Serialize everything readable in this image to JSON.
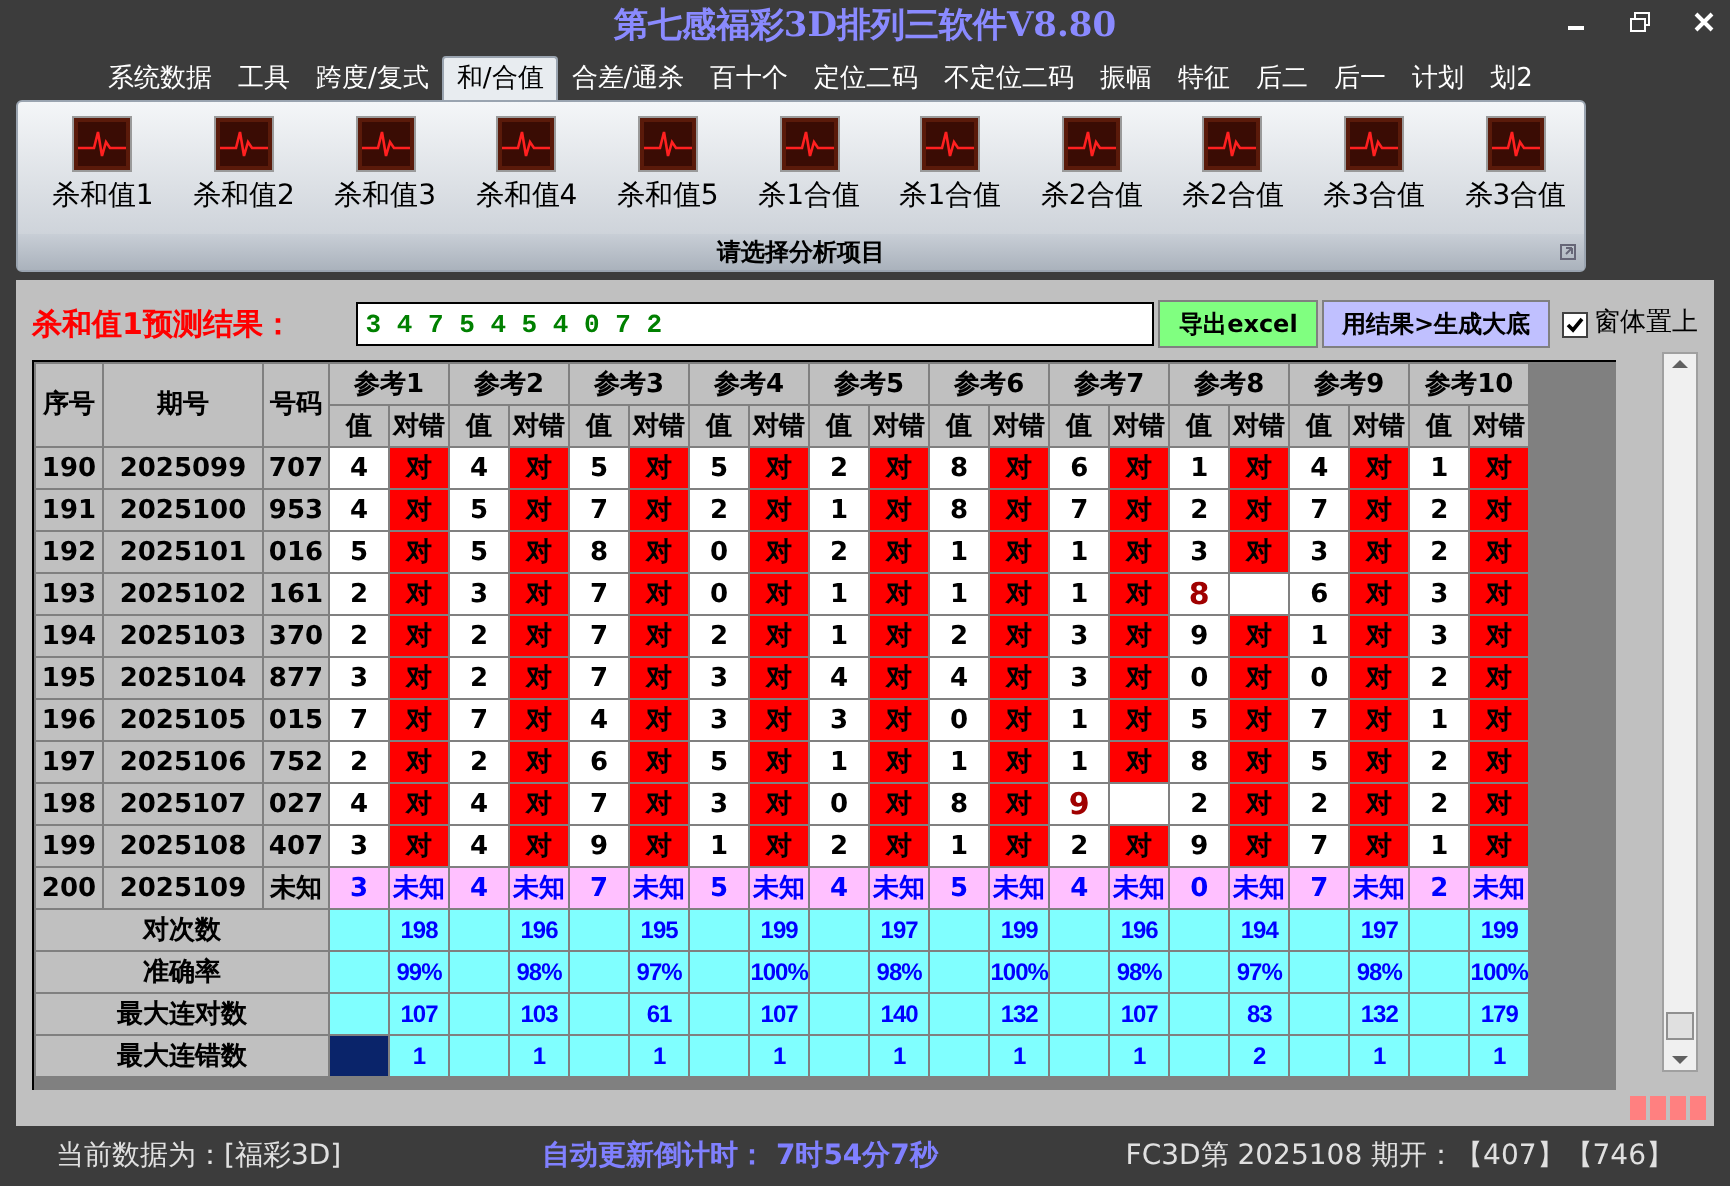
{
  "window": {
    "title": "第七感福彩3D排列三软件V8.80"
  },
  "tabs": [
    {
      "label": "系统数据",
      "selected": false
    },
    {
      "label": "工具",
      "selected": false
    },
    {
      "label": "跨度/复式",
      "selected": false
    },
    {
      "label": "和/合值",
      "selected": true
    },
    {
      "label": "合差/通杀",
      "selected": false
    },
    {
      "label": "百十个",
      "selected": false
    },
    {
      "label": "定位二码",
      "selected": false
    },
    {
      "label": "不定位二码",
      "selected": false
    },
    {
      "label": "振幅",
      "selected": false
    },
    {
      "label": "特征",
      "selected": false
    },
    {
      "label": "后二",
      "selected": false
    },
    {
      "label": "后一",
      "selected": false
    },
    {
      "label": "计划",
      "selected": false
    },
    {
      "label": "划2",
      "selected": false
    }
  ],
  "ribbon": {
    "items": [
      "杀和值1",
      "杀和值2",
      "杀和值3",
      "杀和值4",
      "杀和值5",
      "杀1合值",
      "杀1合值",
      "杀2合值",
      "杀2合值",
      "杀3合值",
      "杀3合值"
    ],
    "group_label": "请选择分析项目"
  },
  "prediction": {
    "label": "杀和值1预测结果：",
    "value": "3 4 7 5 4 5 4 0 7 2",
    "buttons": [
      {
        "label": "导出excel",
        "kind": "export"
      },
      {
        "label": "用结果>生成大底",
        "kind": "generate"
      }
    ],
    "checkbox": {
      "label": "窗体置上",
      "checked": true
    }
  },
  "table": {
    "columns": [
      "序号",
      "期号",
      "号码"
    ],
    "refs": [
      {
        "label": "参考1",
        "sub": [
          "值",
          "对错"
        ]
      },
      {
        "label": "参考2",
        "sub": [
          "值",
          "对错"
        ]
      },
      {
        "label": "参考3",
        "sub": [
          "值",
          "对错"
        ]
      },
      {
        "label": "参考4",
        "sub": [
          "值",
          "对错"
        ]
      },
      {
        "label": "参考5",
        "sub": [
          "值",
          "对错"
        ]
      },
      {
        "label": "参考6",
        "sub": [
          "值",
          "对错"
        ]
      },
      {
        "label": "参考7",
        "sub": [
          "值",
          "对错"
        ]
      },
      {
        "label": "参考8",
        "sub": [
          "值",
          "对错"
        ]
      },
      {
        "label": "参考9",
        "sub": [
          "值",
          "对错"
        ]
      },
      {
        "label": "参考10",
        "sub": [
          "值",
          "对错"
        ]
      }
    ],
    "rows": [
      {
        "index": "190",
        "issue": "2025099",
        "number": "707",
        "cells": [
          {
            "value": "4",
            "hit": true,
            "result": "对"
          },
          {
            "value": "4",
            "hit": true,
            "result": "对"
          },
          {
            "value": "5",
            "hit": true,
            "result": "对"
          },
          {
            "value": "5",
            "hit": true,
            "result": "对"
          },
          {
            "value": "2",
            "hit": true,
            "result": "对"
          },
          {
            "value": "8",
            "hit": true,
            "result": "对"
          },
          {
            "value": "6",
            "hit": true,
            "result": "对"
          },
          {
            "value": "1",
            "hit": true,
            "result": "对"
          },
          {
            "value": "4",
            "hit": true,
            "result": "对"
          },
          {
            "value": "1",
            "hit": true,
            "result": "对"
          }
        ]
      },
      {
        "index": "191",
        "issue": "2025100",
        "number": "953",
        "cells": [
          {
            "value": "4",
            "hit": true,
            "result": "对"
          },
          {
            "value": "5",
            "hit": true,
            "result": "对"
          },
          {
            "value": "7",
            "hit": true,
            "result": "对"
          },
          {
            "value": "2",
            "hit": true,
            "result": "对"
          },
          {
            "value": "1",
            "hit": true,
            "result": "对"
          },
          {
            "value": "8",
            "hit": true,
            "result": "对"
          },
          {
            "value": "7",
            "hit": true,
            "result": "对"
          },
          {
            "value": "2",
            "hit": true,
            "result": "对"
          },
          {
            "value": "7",
            "hit": true,
            "result": "对"
          },
          {
            "value": "2",
            "hit": true,
            "result": "对"
          }
        ]
      },
      {
        "index": "192",
        "issue": "2025101",
        "number": "016",
        "cells": [
          {
            "value": "5",
            "hit": true,
            "result": "对"
          },
          {
            "value": "5",
            "hit": true,
            "result": "对"
          },
          {
            "value": "8",
            "hit": true,
            "result": "对"
          },
          {
            "value": "0",
            "hit": true,
            "result": "对"
          },
          {
            "value": "2",
            "hit": true,
            "result": "对"
          },
          {
            "value": "1",
            "hit": true,
            "result": "对"
          },
          {
            "value": "1",
            "hit": true,
            "result": "对"
          },
          {
            "value": "3",
            "hit": true,
            "result": "对"
          },
          {
            "value": "3",
            "hit": true,
            "result": "对"
          },
          {
            "value": "2",
            "hit": true,
            "result": "对"
          }
        ]
      },
      {
        "index": "193",
        "issue": "2025102",
        "number": "161",
        "cells": [
          {
            "value": "2",
            "hit": true,
            "result": "对"
          },
          {
            "value": "3",
            "hit": true,
            "result": "对"
          },
          {
            "value": "7",
            "hit": true,
            "result": "对"
          },
          {
            "value": "0",
            "hit": true,
            "result": "对"
          },
          {
            "value": "1",
            "hit": true,
            "result": "对"
          },
          {
            "value": "1",
            "hit": true,
            "result": "对"
          },
          {
            "value": "1",
            "hit": true,
            "result": "对"
          },
          {
            "value": "8",
            "hit": false
          },
          {
            "value": "6",
            "hit": true,
            "result": "对"
          },
          {
            "value": "3",
            "hit": true,
            "result": "对"
          }
        ]
      },
      {
        "index": "194",
        "issue": "2025103",
        "number": "370",
        "cells": [
          {
            "value": "2",
            "hit": true,
            "result": "对"
          },
          {
            "value": "2",
            "hit": true,
            "result": "对"
          },
          {
            "value": "7",
            "hit": true,
            "result": "对"
          },
          {
            "value": "2",
            "hit": true,
            "result": "对"
          },
          {
            "value": "1",
            "hit": true,
            "result": "对"
          },
          {
            "value": "2",
            "hit": true,
            "result": "对"
          },
          {
            "value": "3",
            "hit": true,
            "result": "对"
          },
          {
            "value": "9",
            "hit": true,
            "result": "对"
          },
          {
            "value": "1",
            "hit": true,
            "result": "对"
          },
          {
            "value": "3",
            "hit": true,
            "result": "对"
          }
        ]
      },
      {
        "index": "195",
        "issue": "2025104",
        "number": "877",
        "cells": [
          {
            "value": "3",
            "hit": true,
            "result": "对"
          },
          {
            "value": "2",
            "hit": true,
            "result": "对"
          },
          {
            "value": "7",
            "hit": true,
            "result": "对"
          },
          {
            "value": "3",
            "hit": true,
            "result": "对"
          },
          {
            "value": "4",
            "hit": true,
            "result": "对"
          },
          {
            "value": "4",
            "hit": true,
            "result": "对"
          },
          {
            "value": "3",
            "hit": true,
            "result": "对"
          },
          {
            "value": "0",
            "hit": true,
            "result": "对"
          },
          {
            "value": "0",
            "hit": true,
            "result": "对"
          },
          {
            "value": "2",
            "hit": true,
            "result": "对"
          }
        ]
      },
      {
        "index": "196",
        "issue": "2025105",
        "number": "015",
        "cells": [
          {
            "value": "7",
            "hit": true,
            "result": "对"
          },
          {
            "value": "7",
            "hit": true,
            "result": "对"
          },
          {
            "value": "4",
            "hit": true,
            "result": "对"
          },
          {
            "value": "3",
            "hit": true,
            "result": "对"
          },
          {
            "value": "3",
            "hit": true,
            "result": "对"
          },
          {
            "value": "0",
            "hit": true,
            "result": "对"
          },
          {
            "value": "1",
            "hit": true,
            "result": "对"
          },
          {
            "value": "5",
            "hit": true,
            "result": "对"
          },
          {
            "value": "7",
            "hit": true,
            "result": "对"
          },
          {
            "value": "1",
            "hit": true,
            "result": "对"
          }
        ]
      },
      {
        "index": "197",
        "issue": "2025106",
        "number": "752",
        "cells": [
          {
            "value": "2",
            "hit": true,
            "result": "对"
          },
          {
            "value": "2",
            "hit": true,
            "result": "对"
          },
          {
            "value": "6",
            "hit": true,
            "result": "对"
          },
          {
            "value": "5",
            "hit": true,
            "result": "对"
          },
          {
            "value": "1",
            "hit": true,
            "result": "对"
          },
          {
            "value": "1",
            "hit": true,
            "result": "对"
          },
          {
            "value": "1",
            "hit": true,
            "result": "对"
          },
          {
            "value": "8",
            "hit": true,
            "result": "对"
          },
          {
            "value": "5",
            "hit": true,
            "result": "对"
          },
          {
            "value": "2",
            "hit": true,
            "result": "对"
          }
        ]
      },
      {
        "index": "198",
        "issue": "2025107",
        "number": "027",
        "cells": [
          {
            "value": "4",
            "hit": true,
            "result": "对"
          },
          {
            "value": "4",
            "hit": true,
            "result": "对"
          },
          {
            "value": "7",
            "hit": true,
            "result": "对"
          },
          {
            "value": "3",
            "hit": true,
            "result": "对"
          },
          {
            "value": "0",
            "hit": true,
            "result": "对"
          },
          {
            "value": "8",
            "hit": true,
            "result": "对"
          },
          {
            "value": "9",
            "hit": false
          },
          {
            "value": "2",
            "hit": true,
            "result": "对"
          },
          {
            "value": "2",
            "hit": true,
            "result": "对"
          },
          {
            "value": "2",
            "hit": true,
            "result": "对"
          }
        ]
      },
      {
        "index": "199",
        "issue": "2025108",
        "number": "407",
        "cells": [
          {
            "value": "3",
            "hit": true,
            "result": "对"
          },
          {
            "value": "4",
            "hit": true,
            "result": "对"
          },
          {
            "value": "9",
            "hit": true,
            "result": "对"
          },
          {
            "value": "1",
            "hit": true,
            "result": "对"
          },
          {
            "value": "2",
            "hit": true,
            "result": "对"
          },
          {
            "value": "1",
            "hit": true,
            "result": "对"
          },
          {
            "value": "2",
            "hit": true,
            "result": "对"
          },
          {
            "value": "9",
            "hit": true,
            "result": "对"
          },
          {
            "value": "7",
            "hit": true,
            "result": "对"
          },
          {
            "value": "1",
            "hit": true,
            "result": "对"
          }
        ]
      }
    ],
    "forecast": {
      "index": "200",
      "issue": "2025109",
      "number": "未知",
      "cells": [
        {
          "value": "3",
          "result": "未知"
        },
        {
          "value": "4",
          "result": "未知"
        },
        {
          "value": "7",
          "result": "未知"
        },
        {
          "value": "5",
          "result": "未知"
        },
        {
          "value": "4",
          "result": "未知"
        },
        {
          "value": "5",
          "result": "未知"
        },
        {
          "value": "4",
          "result": "未知"
        },
        {
          "value": "0",
          "result": "未知"
        },
        {
          "value": "7",
          "result": "未知"
        },
        {
          "value": "2",
          "result": "未知"
        }
      ]
    },
    "stats": [
      {
        "label": "对次数",
        "selected": false,
        "values": [
          "198",
          "196",
          "195",
          "199",
          "197",
          "199",
          "196",
          "194",
          "197",
          "199"
        ]
      },
      {
        "label": "准确率",
        "selected": false,
        "values": [
          "99%",
          "98%",
          "97%",
          "100%",
          "98%",
          "100%",
          "98%",
          "97%",
          "98%",
          "100%"
        ]
      },
      {
        "label": "最大连对数",
        "selected": false,
        "values": [
          "107",
          "103",
          "61",
          "107",
          "140",
          "132",
          "107",
          "83",
          "132",
          "179"
        ]
      },
      {
        "label": "最大连错数",
        "selected": true,
        "values": [
          "1",
          "1",
          "1",
          "1",
          "1",
          "1",
          "1",
          "2",
          "1",
          "1"
        ]
      }
    ]
  },
  "status_bar": {
    "data_source": "当前数据为：[福彩3D]",
    "countdown": "自动更新倒计时： 7时54分7秒",
    "latest": "FC3D第 2025108 期开：【407】【746】"
  }
}
